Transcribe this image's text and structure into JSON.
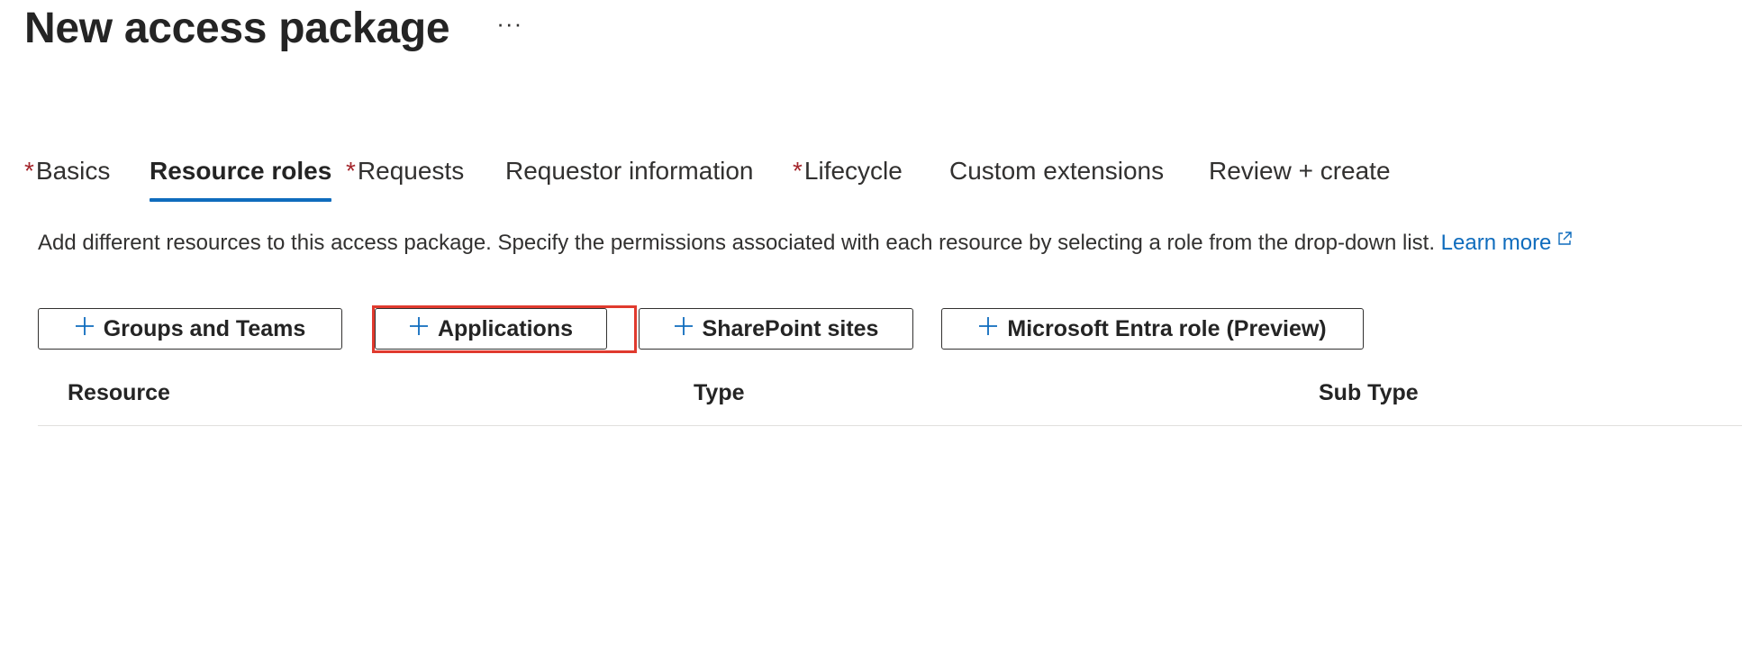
{
  "header": {
    "title": "New access package",
    "more_label": "···"
  },
  "tabs": [
    {
      "label": "Basics",
      "required": true,
      "active": false
    },
    {
      "label": "Resource roles",
      "required": false,
      "active": true
    },
    {
      "label": "Requests",
      "required": true,
      "active": false
    },
    {
      "label": "Requestor information",
      "required": false,
      "active": false
    },
    {
      "label": "Lifecycle",
      "required": true,
      "active": false
    },
    {
      "label": "Custom extensions",
      "required": false,
      "active": false
    },
    {
      "label": "Review + create",
      "required": false,
      "active": false
    }
  ],
  "required_marker": "*",
  "description": {
    "text": "Add different resources to this access package. Specify the permissions associated with each resource by selecting a role from the drop-down list.",
    "link_label": "Learn more"
  },
  "buttons": {
    "groups_and_teams": "Groups and Teams",
    "applications": "Applications",
    "sharepoint_sites": "SharePoint sites",
    "entra_role": "Microsoft Entra role (Preview)"
  },
  "table": {
    "columns": [
      "Resource",
      "Type",
      "Sub Type"
    ]
  },
  "colors": {
    "accent": "#0f6cbd",
    "required": "#a4262c",
    "highlight": "#e03a2e"
  },
  "icons": {
    "plus": "plus-icon",
    "external_link": "external-link-icon",
    "more": "more-icon"
  }
}
